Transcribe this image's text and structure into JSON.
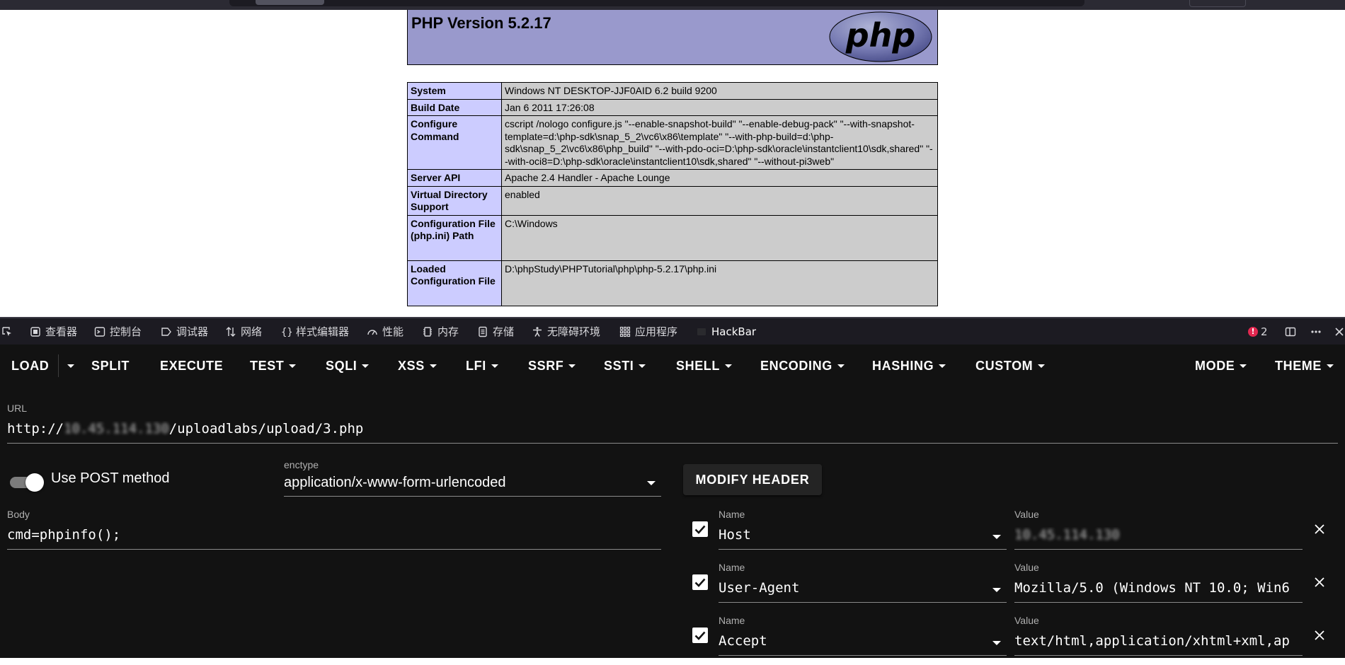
{
  "phpinfo": {
    "version_title": "PHP Version 5.2.17",
    "logo_text": "php",
    "rows": [
      {
        "key": "System",
        "value": "Windows NT DESKTOP-JJF0AID 6.2 build 9200"
      },
      {
        "key": "Build Date",
        "value": "Jan 6 2011 17:26:08"
      },
      {
        "key": "Configure Command",
        "value": "cscript /nologo configure.js \"--enable-snapshot-build\" \"--enable-debug-pack\" \"--with-snapshot-template=d:\\php-sdk\\snap_5_2\\vc6\\x86\\template\" \"--with-php-build=d:\\php-sdk\\snap_5_2\\vc6\\x86\\php_build\" \"--with-pdo-oci=D:\\php-sdk\\oracle\\instantclient10\\sdk,shared\" \"--with-oci8=D:\\php-sdk\\oracle\\instantclient10\\sdk,shared\" \"--without-pi3web\""
      },
      {
        "key": "Server API",
        "value": "Apache 2.4 Handler - Apache Lounge"
      },
      {
        "key": "Virtual Directory Support",
        "value": "enabled"
      },
      {
        "key": "Configuration File (php.ini) Path",
        "value": "C:\\Windows"
      },
      {
        "key": "Loaded Configuration File",
        "value": "D:\\phpStudy\\PHPTutorial\\php\\php-5.2.17\\php.ini"
      }
    ]
  },
  "devtools": {
    "tabs": [
      {
        "label": "查看器",
        "icon": "inspector-icon"
      },
      {
        "label": "控制台",
        "icon": "console-icon"
      },
      {
        "label": "调试器",
        "icon": "debugger-icon"
      },
      {
        "label": "网络",
        "icon": "network-icon"
      },
      {
        "label": "样式编辑器",
        "icon": "style-editor-icon"
      },
      {
        "label": "性能",
        "icon": "performance-icon"
      },
      {
        "label": "内存",
        "icon": "memory-icon"
      },
      {
        "label": "存储",
        "icon": "storage-icon"
      },
      {
        "label": "无障碍环境",
        "icon": "accessibility-icon"
      },
      {
        "label": "应用程序",
        "icon": "application-icon"
      },
      {
        "label": "HackBar",
        "icon": "hackbar-icon"
      }
    ],
    "error_count": "2",
    "active_tab": "HackBar",
    "accent_color": "#0a84ff",
    "error_color": "#e22850"
  },
  "hackbar": {
    "menu": {
      "load": "LOAD",
      "split": "SPLIT",
      "execute": "EXECUTE",
      "test": "TEST",
      "sqli": "SQLI",
      "xss": "XSS",
      "lfi": "LFI",
      "ssrf": "SSRF",
      "ssti": "SSTI",
      "shell": "SHELL",
      "encoding": "ENCODING",
      "hashing": "HASHING",
      "custom": "CUSTOM",
      "mode": "MODE",
      "theme": "THEME"
    },
    "url": {
      "label": "URL",
      "prefix": "http://",
      "host_blurred": "10.45.114.130",
      "path": "/uploadlabs/upload/3.php"
    },
    "post": {
      "toggle_label": "Use POST method",
      "enabled": true
    },
    "enctype": {
      "label": "enctype",
      "value": "application/x-www-form-urlencoded"
    },
    "modify_header_label": "MODIFY HEADER",
    "body": {
      "label": "Body",
      "value": "cmd=phpinfo();"
    },
    "headers": [
      {
        "name_label": "Name",
        "name": "Host",
        "value_label": "Value",
        "value": "10.45.114.130",
        "value_blurred": true,
        "checked": true
      },
      {
        "name_label": "Name",
        "name": "User-Agent",
        "value_label": "Value",
        "value": "Mozilla/5.0 (Windows NT 10.0; Win6",
        "value_blurred": false,
        "checked": true
      },
      {
        "name_label": "Name",
        "name": "Accept",
        "value_label": "Value",
        "value": "text/html,application/xhtml+xml,ap",
        "value_blurred": false,
        "checked": true
      }
    ],
    "background_color": "#121212"
  }
}
